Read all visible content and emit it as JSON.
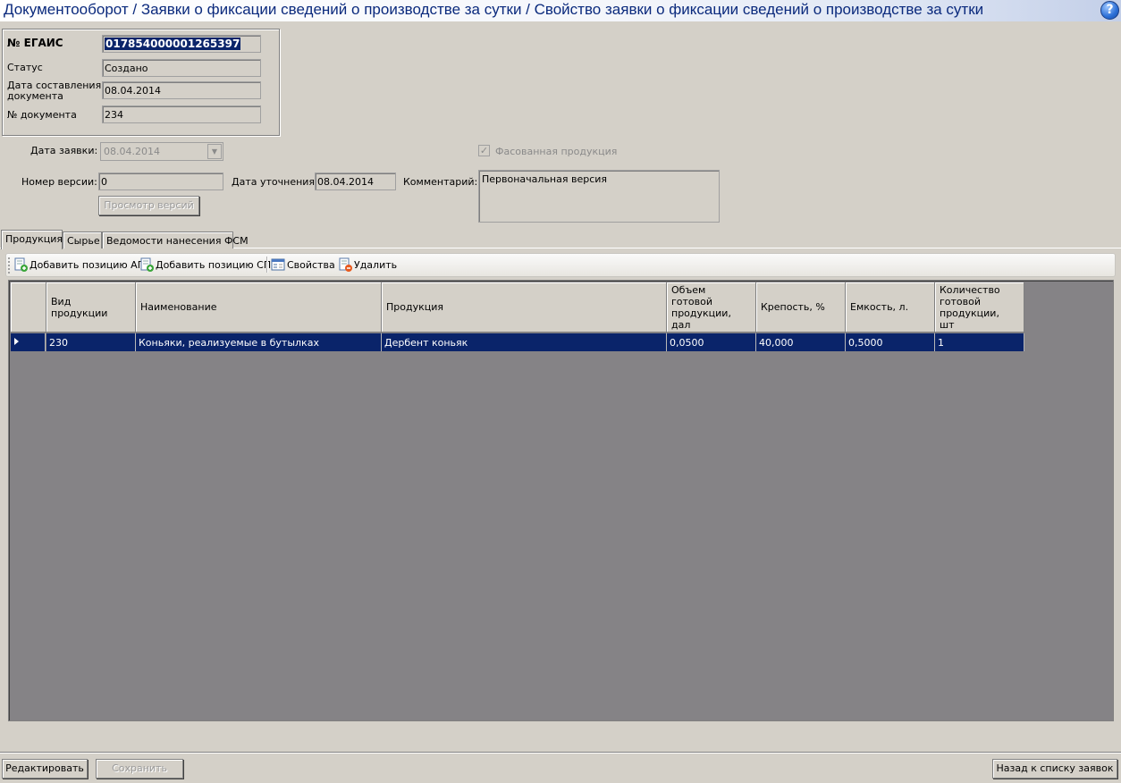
{
  "window": {
    "title": "Документооборот / Заявки о фиксации сведений о производстве за сутки / Свойство заявки о фиксации сведений о производстве за сутки",
    "help_icon": "help-icon",
    "help_symbol": "?"
  },
  "info": {
    "egais_label": "№ ЕГАИС",
    "egais_value": "0178540000012653​97",
    "status_label": "Статус",
    "status_value": "Создано",
    "doc_date_label_1": "Дата составления",
    "doc_date_label_2": "документа",
    "doc_date_value": "08.04.2014",
    "doc_num_label": "№ документа",
    "doc_num_value": "234"
  },
  "request": {
    "date_label": "Дата заявки:",
    "date_value": "08.04.2014",
    "packaged_label": "Фасованная продукция",
    "packaged_checked": true,
    "version_label": "Номер версии:",
    "version_value": "0",
    "clarify_date_label": "Дата уточнения:",
    "clarify_date_value": "08.04.2014",
    "comment_label": "Комментарий:",
    "comment_value": "Первоначальная версия",
    "view_versions_button": "Просмотр версий"
  },
  "tabs": [
    {
      "label": "Продукция",
      "active": true
    },
    {
      "label": "Сырье",
      "active": false
    },
    {
      "label": "Ведомости нанесения ФСМ",
      "active": false
    }
  ],
  "toolbar": {
    "add_ap": "Добавить позицию АП",
    "add_sp": "Добавить позицию СП",
    "properties": "Свойства",
    "delete": "Удалить"
  },
  "grid": {
    "columns": [
      {
        "h1": "Вид",
        "h2": "продукции",
        "h3": "",
        "h4": ""
      },
      {
        "h1": "Наименование",
        "h2": "",
        "h3": "",
        "h4": ""
      },
      {
        "h1": "Продукция",
        "h2": "",
        "h3": "",
        "h4": ""
      },
      {
        "h1": "Объем",
        "h2": "готовой",
        "h3": "продукции,",
        "h4": "дал"
      },
      {
        "h1": "Крепость, %",
        "h2": "",
        "h3": "",
        "h4": ""
      },
      {
        "h1": "Емкость, л.",
        "h2": "",
        "h3": "",
        "h4": ""
      },
      {
        "h1": "Количество",
        "h2": "готовой",
        "h3": "продукции,",
        "h4": "шт"
      }
    ],
    "rows": [
      [
        "230",
        "Коньяки, реализуемые в бутылках",
        "Дербент коньяк",
        "0,0500",
        "40,000",
        "0,5000",
        "1"
      ]
    ],
    "selection_color": "#0a246a"
  },
  "footer": {
    "edit_button": "Редактировать",
    "save_button": "Сохранить",
    "back_button": "Назад к списку заявок"
  }
}
